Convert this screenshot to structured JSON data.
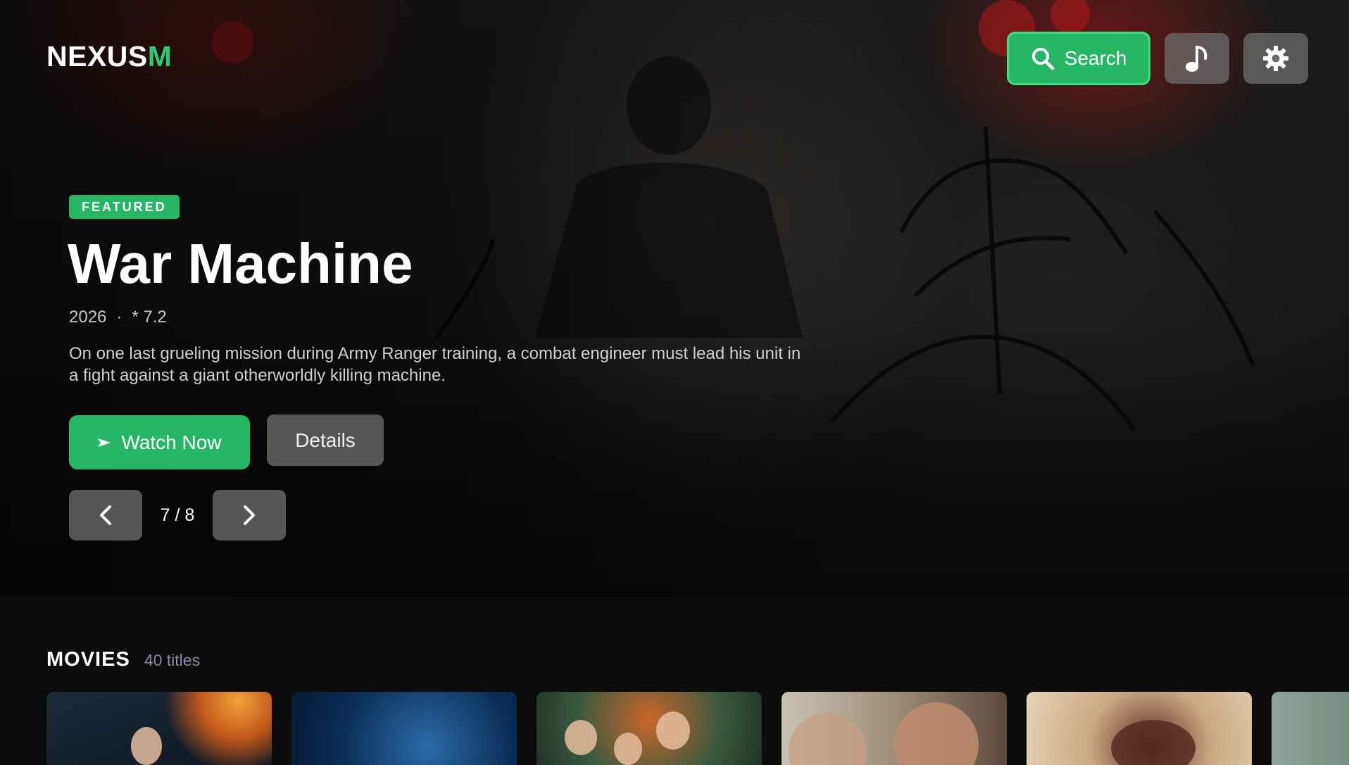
{
  "header": {
    "logo_main": "NEXUS",
    "logo_accent": "M",
    "search_label": "Search",
    "music_icon": "music-note-icon",
    "settings_icon": "gear-icon"
  },
  "hero": {
    "badge": "FEATURED",
    "title": "War Machine",
    "year": "2026",
    "separator": "·",
    "rating": "* 7.2",
    "description": "On one last grueling mission during Army Ranger training, a combat engineer must lead his unit in a fight against a giant otherworldly killing machine.",
    "watch_label": "Watch Now",
    "details_label": "Details",
    "pager_text": "7 / 8"
  },
  "section": {
    "title": "MOVIES",
    "count": "40 titles",
    "posters": [
      {
        "name": "poster-1"
      },
      {
        "name": "poster-2"
      },
      {
        "name": "poster-3"
      },
      {
        "name": "poster-4"
      },
      {
        "name": "poster-5"
      },
      {
        "name": "poster-6"
      }
    ]
  },
  "colors": {
    "accent": "#27b663",
    "background": "#0c0c0d"
  }
}
